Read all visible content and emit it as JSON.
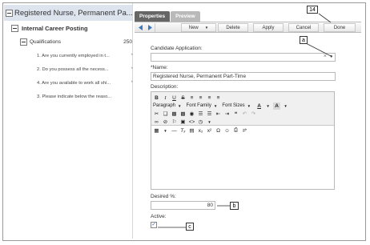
{
  "tree": {
    "root_label": "Registered Nurse, Permanent Pa...",
    "posting_label": "Internal Career Posting",
    "qualifications_label": "Qualifications",
    "qualifications_count": "250",
    "questions": [
      {
        "label": "1. Are you currently employed in t...",
        "mark": "*"
      },
      {
        "label": "2. Do you possess all the necess...",
        "mark": "*"
      },
      {
        "label": "4. Are you available to work all shi...",
        "mark": "*"
      },
      {
        "label": "3. Please indicate below the reaso...",
        "mark": ""
      }
    ]
  },
  "tabs": [
    {
      "label": "Properties",
      "active": true
    },
    {
      "label": "Preview",
      "active": false
    }
  ],
  "toolbar": {
    "new_label": "New",
    "delete_label": "Delete",
    "apply_label": "Apply",
    "cancel_label": "Cancel",
    "done_label": "Done"
  },
  "form": {
    "candidate_application_label": "Candidate Application:",
    "candidate_application_value": "",
    "name_label": "*Name:",
    "name_value": "Registered Nurse, Permanent Part-Time",
    "description_label": "Description:",
    "editor": {
      "paragraph_label": "Paragraph",
      "font_family_label": "Font Family",
      "font_sizes_label": "Font Sizes"
    },
    "desired_label": "Desired %:",
    "desired_value": "80",
    "active_label": "Active:",
    "active_checked": true
  },
  "callouts": {
    "done_callout": "14",
    "a": "a",
    "b": "b",
    "c": "c"
  },
  "colors": {
    "tree_selected": "#dde4ee",
    "tab_active": "#666666",
    "tab_inactive": "#b9b9b9",
    "nav_arrow": "#3a78c0"
  }
}
